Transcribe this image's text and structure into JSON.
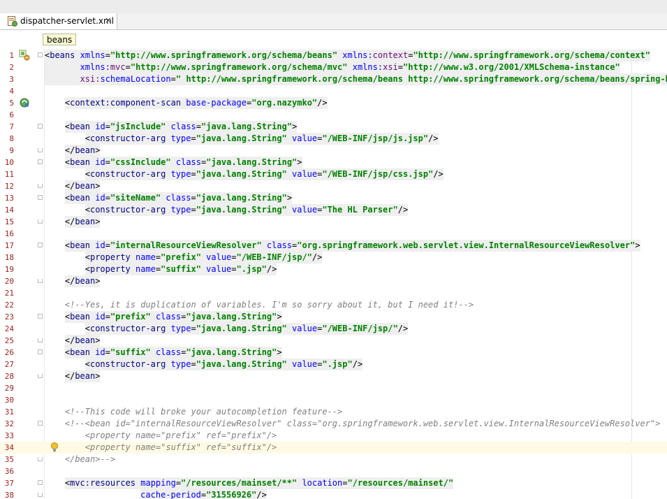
{
  "tab": {
    "filename": "dispatcher-servlet.xml",
    "close_symbol": "×"
  },
  "breadcrumb": {
    "label": "beans"
  },
  "lines": [
    {
      "n": "1",
      "indent": 0,
      "fold": "start",
      "gutter_icon": "spring-bean-icon",
      "tagbg": true,
      "tokens": [
        {
          "t": "<",
          "c": "tk-punct"
        },
        {
          "t": "beans",
          "c": "tk-tag"
        },
        {
          "t": " xmlns",
          "c": "tk-attr"
        },
        {
          "t": "=",
          "c": "tk-punct"
        },
        {
          "t": "\"http://www.springframework.org/schema/beans\"",
          "c": "tk-val"
        },
        {
          "t": " xmlns:",
          "c": "tk-attr"
        },
        {
          "t": "context",
          "c": "tk-ns"
        },
        {
          "t": "=",
          "c": "tk-punct"
        },
        {
          "t": "\"http://www.springframework.org/schema/context\"",
          "c": "tk-val"
        }
      ]
    },
    {
      "n": "2",
      "indent": 0,
      "tagbg": true,
      "tokens": [
        {
          "t": "       xmlns:",
          "c": "tk-attr"
        },
        {
          "t": "mvc",
          "c": "tk-ns"
        },
        {
          "t": "=",
          "c": "tk-punct"
        },
        {
          "t": "\"http://www.springframework.org/schema/mvc\"",
          "c": "tk-val"
        },
        {
          "t": " xmlns:",
          "c": "tk-attr"
        },
        {
          "t": "xsi",
          "c": "tk-ns"
        },
        {
          "t": "=",
          "c": "tk-punct"
        },
        {
          "t": "\"http://www.w3.org/2001/XMLSchema-instance\"",
          "c": "tk-val"
        }
      ]
    },
    {
      "n": "3",
      "indent": 0,
      "tagbg": true,
      "tokens": [
        {
          "t": "       xsi:",
          "c": "tk-ns"
        },
        {
          "t": "schemaLocation",
          "c": "tk-attr"
        },
        {
          "t": "=",
          "c": "tk-punct"
        },
        {
          "t": "\" http://www.springframework.org/schema/beans http://www.springframework.org/schema/beans/spring-beans.xsd",
          "c": "tk-val"
        }
      ]
    },
    {
      "n": "4",
      "indent": 0,
      "tokens": []
    },
    {
      "n": "5",
      "indent": 4,
      "gutter_icon": "component-scan-icon",
      "tagbg": true,
      "tokens": [
        {
          "t": "<",
          "c": "tk-punct"
        },
        {
          "t": "context:component-scan",
          "c": "tk-tag"
        },
        {
          "t": " base-package",
          "c": "tk-attr"
        },
        {
          "t": "=",
          "c": "tk-punct"
        },
        {
          "t": "\"org.nazymko\"",
          "c": "tk-val"
        },
        {
          "t": "/>",
          "c": "tk-punct"
        }
      ]
    },
    {
      "n": "6",
      "indent": 0,
      "tokens": []
    },
    {
      "n": "7",
      "indent": 4,
      "fold": "start",
      "tagbg": true,
      "tokens": [
        {
          "t": "<",
          "c": "tk-punct"
        },
        {
          "t": "bean",
          "c": "tk-tag"
        },
        {
          "t": " id",
          "c": "tk-attr"
        },
        {
          "t": "=",
          "c": "tk-punct"
        },
        {
          "t": "\"jsInclude\"",
          "c": "tk-val"
        },
        {
          "t": " class",
          "c": "tk-attr"
        },
        {
          "t": "=",
          "c": "tk-punct"
        },
        {
          "t": "\"java.lang.String\"",
          "c": "tk-val"
        },
        {
          "t": ">",
          "c": "tk-punct"
        }
      ]
    },
    {
      "n": "8",
      "indent": 8,
      "tagbg": true,
      "tokens": [
        {
          "t": "<",
          "c": "tk-punct"
        },
        {
          "t": "constructor-arg",
          "c": "tk-tag"
        },
        {
          "t": " type",
          "c": "tk-attr"
        },
        {
          "t": "=",
          "c": "tk-punct"
        },
        {
          "t": "\"java.lang.String\"",
          "c": "tk-val"
        },
        {
          "t": " value",
          "c": "tk-attr"
        },
        {
          "t": "=",
          "c": "tk-punct"
        },
        {
          "t": "\"/WEB-INF/jsp/js.jsp\"",
          "c": "tk-val"
        },
        {
          "t": "/>",
          "c": "tk-punct"
        }
      ]
    },
    {
      "n": "9",
      "indent": 4,
      "fold": "end",
      "tagbg": true,
      "tokens": [
        {
          "t": "</",
          "c": "tk-punct"
        },
        {
          "t": "bean",
          "c": "tk-tag"
        },
        {
          "t": ">",
          "c": "tk-punct"
        }
      ]
    },
    {
      "n": "10",
      "indent": 4,
      "fold": "start",
      "tagbg": true,
      "tokens": [
        {
          "t": "<",
          "c": "tk-punct"
        },
        {
          "t": "bean",
          "c": "tk-tag"
        },
        {
          "t": " id",
          "c": "tk-attr"
        },
        {
          "t": "=",
          "c": "tk-punct"
        },
        {
          "t": "\"cssInclude\"",
          "c": "tk-val"
        },
        {
          "t": " class",
          "c": "tk-attr"
        },
        {
          "t": "=",
          "c": "tk-punct"
        },
        {
          "t": "\"java.lang.String\"",
          "c": "tk-val"
        },
        {
          "t": ">",
          "c": "tk-punct"
        }
      ]
    },
    {
      "n": "11",
      "indent": 8,
      "tagbg": true,
      "tokens": [
        {
          "t": "<",
          "c": "tk-punct"
        },
        {
          "t": "constructor-arg",
          "c": "tk-tag"
        },
        {
          "t": " type",
          "c": "tk-attr"
        },
        {
          "t": "=",
          "c": "tk-punct"
        },
        {
          "t": "\"java.lang.String\"",
          "c": "tk-val"
        },
        {
          "t": " value",
          "c": "tk-attr"
        },
        {
          "t": "=",
          "c": "tk-punct"
        },
        {
          "t": "\"/WEB-INF/jsp/css.jsp\"",
          "c": "tk-val"
        },
        {
          "t": "/>",
          "c": "tk-punct"
        }
      ]
    },
    {
      "n": "12",
      "indent": 4,
      "fold": "end",
      "tagbg": true,
      "tokens": [
        {
          "t": "</",
          "c": "tk-punct"
        },
        {
          "t": "bean",
          "c": "tk-tag"
        },
        {
          "t": ">",
          "c": "tk-punct"
        }
      ]
    },
    {
      "n": "13",
      "indent": 4,
      "fold": "start",
      "tagbg": true,
      "tokens": [
        {
          "t": "<",
          "c": "tk-punct"
        },
        {
          "t": "bean",
          "c": "tk-tag"
        },
        {
          "t": " id",
          "c": "tk-attr"
        },
        {
          "t": "=",
          "c": "tk-punct"
        },
        {
          "t": "\"siteName\"",
          "c": "tk-val"
        },
        {
          "t": " class",
          "c": "tk-attr"
        },
        {
          "t": "=",
          "c": "tk-punct"
        },
        {
          "t": "\"java.lang.String\"",
          "c": "tk-val"
        },
        {
          "t": ">",
          "c": "tk-punct"
        }
      ]
    },
    {
      "n": "14",
      "indent": 8,
      "tagbg": true,
      "tokens": [
        {
          "t": "<",
          "c": "tk-punct"
        },
        {
          "t": "constructor-arg",
          "c": "tk-tag"
        },
        {
          "t": " type",
          "c": "tk-attr"
        },
        {
          "t": "=",
          "c": "tk-punct"
        },
        {
          "t": "\"java.lang.String\"",
          "c": "tk-val"
        },
        {
          "t": " value",
          "c": "tk-attr"
        },
        {
          "t": "=",
          "c": "tk-punct"
        },
        {
          "t": "\"The HL Parser\"",
          "c": "tk-val"
        },
        {
          "t": "/>",
          "c": "tk-punct"
        }
      ]
    },
    {
      "n": "15",
      "indent": 4,
      "fold": "end",
      "tagbg": true,
      "tokens": [
        {
          "t": "</",
          "c": "tk-punct"
        },
        {
          "t": "bean",
          "c": "tk-tag"
        },
        {
          "t": ">",
          "c": "tk-punct"
        }
      ]
    },
    {
      "n": "16",
      "indent": 0,
      "tokens": []
    },
    {
      "n": "17",
      "indent": 4,
      "fold": "start",
      "tagbg": true,
      "tokens": [
        {
          "t": "<",
          "c": "tk-punct"
        },
        {
          "t": "bean",
          "c": "tk-tag"
        },
        {
          "t": " id",
          "c": "tk-attr"
        },
        {
          "t": "=",
          "c": "tk-punct"
        },
        {
          "t": "\"internalResourceViewResolver\"",
          "c": "tk-val"
        },
        {
          "t": " class",
          "c": "tk-attr"
        },
        {
          "t": "=",
          "c": "tk-punct"
        },
        {
          "t": "\"org.springframework.web.servlet.view.InternalResourceViewResolver\"",
          "c": "tk-val"
        },
        {
          "t": ">",
          "c": "tk-punct"
        }
      ]
    },
    {
      "n": "18",
      "indent": 8,
      "tagbg": true,
      "tokens": [
        {
          "t": "<",
          "c": "tk-punct"
        },
        {
          "t": "property",
          "c": "tk-tag"
        },
        {
          "t": " name",
          "c": "tk-attr"
        },
        {
          "t": "=",
          "c": "tk-punct"
        },
        {
          "t": "\"prefix\"",
          "c": "tk-val"
        },
        {
          "t": " value",
          "c": "tk-attr"
        },
        {
          "t": "=",
          "c": "tk-punct"
        },
        {
          "t": "\"/WEB-INF/jsp/\"",
          "c": "tk-val"
        },
        {
          "t": "/>",
          "c": "tk-punct"
        }
      ]
    },
    {
      "n": "19",
      "indent": 8,
      "tagbg": true,
      "tokens": [
        {
          "t": "<",
          "c": "tk-punct"
        },
        {
          "t": "property",
          "c": "tk-tag"
        },
        {
          "t": " name",
          "c": "tk-attr"
        },
        {
          "t": "=",
          "c": "tk-punct"
        },
        {
          "t": "\"suffix\"",
          "c": "tk-val"
        },
        {
          "t": " value",
          "c": "tk-attr"
        },
        {
          "t": "=",
          "c": "tk-punct"
        },
        {
          "t": "\".jsp\"",
          "c": "tk-val"
        },
        {
          "t": "/>",
          "c": "tk-punct"
        }
      ]
    },
    {
      "n": "20",
      "indent": 4,
      "fold": "end",
      "tagbg": true,
      "tokens": [
        {
          "t": "</",
          "c": "tk-punct"
        },
        {
          "t": "bean",
          "c": "tk-tag"
        },
        {
          "t": ">",
          "c": "tk-punct"
        }
      ]
    },
    {
      "n": "21",
      "indent": 0,
      "tokens": []
    },
    {
      "n": "22",
      "indent": 4,
      "tokens": [
        {
          "t": "<!--Yes, it is duplication of variables. I'm so sorry about it, but I need it!-->",
          "c": "tk-comment"
        }
      ]
    },
    {
      "n": "23",
      "indent": 4,
      "fold": "start",
      "tagbg": true,
      "tokens": [
        {
          "t": "<",
          "c": "tk-punct"
        },
        {
          "t": "bean",
          "c": "tk-tag"
        },
        {
          "t": " id",
          "c": "tk-attr"
        },
        {
          "t": "=",
          "c": "tk-punct"
        },
        {
          "t": "\"prefix\"",
          "c": "tk-val"
        },
        {
          "t": " class",
          "c": "tk-attr"
        },
        {
          "t": "=",
          "c": "tk-punct"
        },
        {
          "t": "\"java.lang.String\"",
          "c": "tk-val"
        },
        {
          "t": ">",
          "c": "tk-punct"
        }
      ]
    },
    {
      "n": "24",
      "indent": 8,
      "tagbg": true,
      "tokens": [
        {
          "t": "<",
          "c": "tk-punct"
        },
        {
          "t": "constructor-arg",
          "c": "tk-tag"
        },
        {
          "t": " type",
          "c": "tk-attr"
        },
        {
          "t": "=",
          "c": "tk-punct"
        },
        {
          "t": "\"java.lang.String\"",
          "c": "tk-val"
        },
        {
          "t": " value",
          "c": "tk-attr"
        },
        {
          "t": "=",
          "c": "tk-punct"
        },
        {
          "t": "\"/WEB-INF/jsp/\"",
          "c": "tk-val"
        },
        {
          "t": "/>",
          "c": "tk-punct"
        }
      ]
    },
    {
      "n": "25",
      "indent": 4,
      "fold": "end",
      "tagbg": true,
      "tokens": [
        {
          "t": "</",
          "c": "tk-punct"
        },
        {
          "t": "bean",
          "c": "tk-tag"
        },
        {
          "t": ">",
          "c": "tk-punct"
        }
      ]
    },
    {
      "n": "26",
      "indent": 4,
      "fold": "start",
      "tagbg": true,
      "tokens": [
        {
          "t": "<",
          "c": "tk-punct"
        },
        {
          "t": "bean",
          "c": "tk-tag"
        },
        {
          "t": " id",
          "c": "tk-attr"
        },
        {
          "t": "=",
          "c": "tk-punct"
        },
        {
          "t": "\"suffix\"",
          "c": "tk-val"
        },
        {
          "t": " class",
          "c": "tk-attr"
        },
        {
          "t": "=",
          "c": "tk-punct"
        },
        {
          "t": "\"java.lang.String\"",
          "c": "tk-val"
        },
        {
          "t": ">",
          "c": "tk-punct"
        }
      ]
    },
    {
      "n": "27",
      "indent": 8,
      "tagbg": true,
      "tokens": [
        {
          "t": "<",
          "c": "tk-punct"
        },
        {
          "t": "constructor-arg",
          "c": "tk-tag"
        },
        {
          "t": " type",
          "c": "tk-attr"
        },
        {
          "t": "=",
          "c": "tk-punct"
        },
        {
          "t": "\"java.lang.String\"",
          "c": "tk-val"
        },
        {
          "t": " value",
          "c": "tk-attr"
        },
        {
          "t": "=",
          "c": "tk-punct"
        },
        {
          "t": "\".jsp\"",
          "c": "tk-val"
        },
        {
          "t": "/>",
          "c": "tk-punct"
        }
      ]
    },
    {
      "n": "28",
      "indent": 4,
      "fold": "end",
      "tagbg": true,
      "tokens": [
        {
          "t": "</",
          "c": "tk-punct"
        },
        {
          "t": "bean",
          "c": "tk-tag"
        },
        {
          "t": ">",
          "c": "tk-punct"
        }
      ]
    },
    {
      "n": "29",
      "indent": 0,
      "tokens": []
    },
    {
      "n": "30",
      "indent": 0,
      "tokens": []
    },
    {
      "n": "31",
      "indent": 4,
      "tokens": [
        {
          "t": "<!--This code will broke your autocompletion feature-->",
          "c": "tk-comment"
        }
      ]
    },
    {
      "n": "32",
      "indent": 4,
      "fold": "start",
      "tokens": [
        {
          "t": "<!--<bean id=\"internalResourceViewResolver\" class=\"org.springframework.web.servlet.view.InternalResourceViewResolver\">",
          "c": "tk-comment"
        }
      ]
    },
    {
      "n": "33",
      "indent": 8,
      "tokens": [
        {
          "t": "<property name=\"prefix\" ref=\"prefix\"/>",
          "c": "tk-comment"
        }
      ]
    },
    {
      "n": "34",
      "indent": 8,
      "current": true,
      "gutter_icon": "intention-bulb-icon",
      "tokens": [
        {
          "t": "<property name=\"suffix\" ref=\"suffix\"/>",
          "c": "tk-comment"
        }
      ]
    },
    {
      "n": "35",
      "indent": 4,
      "fold": "end",
      "tokens": [
        {
          "t": "</bean>-->",
          "c": "tk-comment"
        }
      ]
    },
    {
      "n": "36",
      "indent": 0,
      "tokens": []
    },
    {
      "n": "37",
      "indent": 4,
      "fold": "start",
      "tagbg": true,
      "tokens": [
        {
          "t": "<",
          "c": "tk-punct"
        },
        {
          "t": "mvc:resources",
          "c": "tk-tag"
        },
        {
          "t": " mapping",
          "c": "tk-attr"
        },
        {
          "t": "=",
          "c": "tk-punct"
        },
        {
          "t": "\"/resources/mainset/**\"",
          "c": "tk-val"
        },
        {
          "t": " location",
          "c": "tk-attr"
        },
        {
          "t": "=",
          "c": "tk-punct"
        },
        {
          "t": "\"/resources/mainset/\"",
          "c": "tk-val"
        }
      ]
    },
    {
      "n": "38",
      "indent": 19,
      "fold": "end",
      "tagbg": true,
      "tokens": [
        {
          "t": "cache-period",
          "c": "tk-attr"
        },
        {
          "t": "=",
          "c": "tk-punct"
        },
        {
          "t": "\"31556926\"",
          "c": "tk-val"
        },
        {
          "t": "/>",
          "c": "tk-punct"
        }
      ]
    }
  ]
}
